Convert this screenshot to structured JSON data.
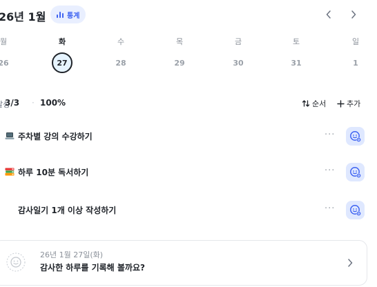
{
  "header": {
    "month_title": "26년 1월",
    "stats_label": "통계",
    "accent_color": "#3e63f1"
  },
  "week": {
    "day_labels": [
      "월",
      "화",
      "수",
      "목",
      "금",
      "토",
      "일"
    ],
    "dates": [
      "26",
      "27",
      "28",
      "29",
      "30",
      "31",
      "1"
    ],
    "selected_index": 1
  },
  "progress": {
    "label": "달성",
    "count": "3/3",
    "separator": "·",
    "percent": "100%",
    "sort_label": "순서",
    "add_label": "추가"
  },
  "todos": [
    {
      "emoji": "laptop-icon",
      "text": "주차별 강의 수강하기",
      "status_icon": "smile-settings-icon"
    },
    {
      "emoji": "books-icon",
      "text": "하루 10분 독서하기",
      "status_icon": "smile-settings-icon"
    },
    {
      "emoji": "",
      "text": "감사일기 1개 이상 작성하기",
      "status_icon": "smile-settings-icon"
    }
  ],
  "journal": {
    "date": "26년 1월 27일(화)",
    "prompt": "감사한 하루를 기록해 볼까요?"
  }
}
